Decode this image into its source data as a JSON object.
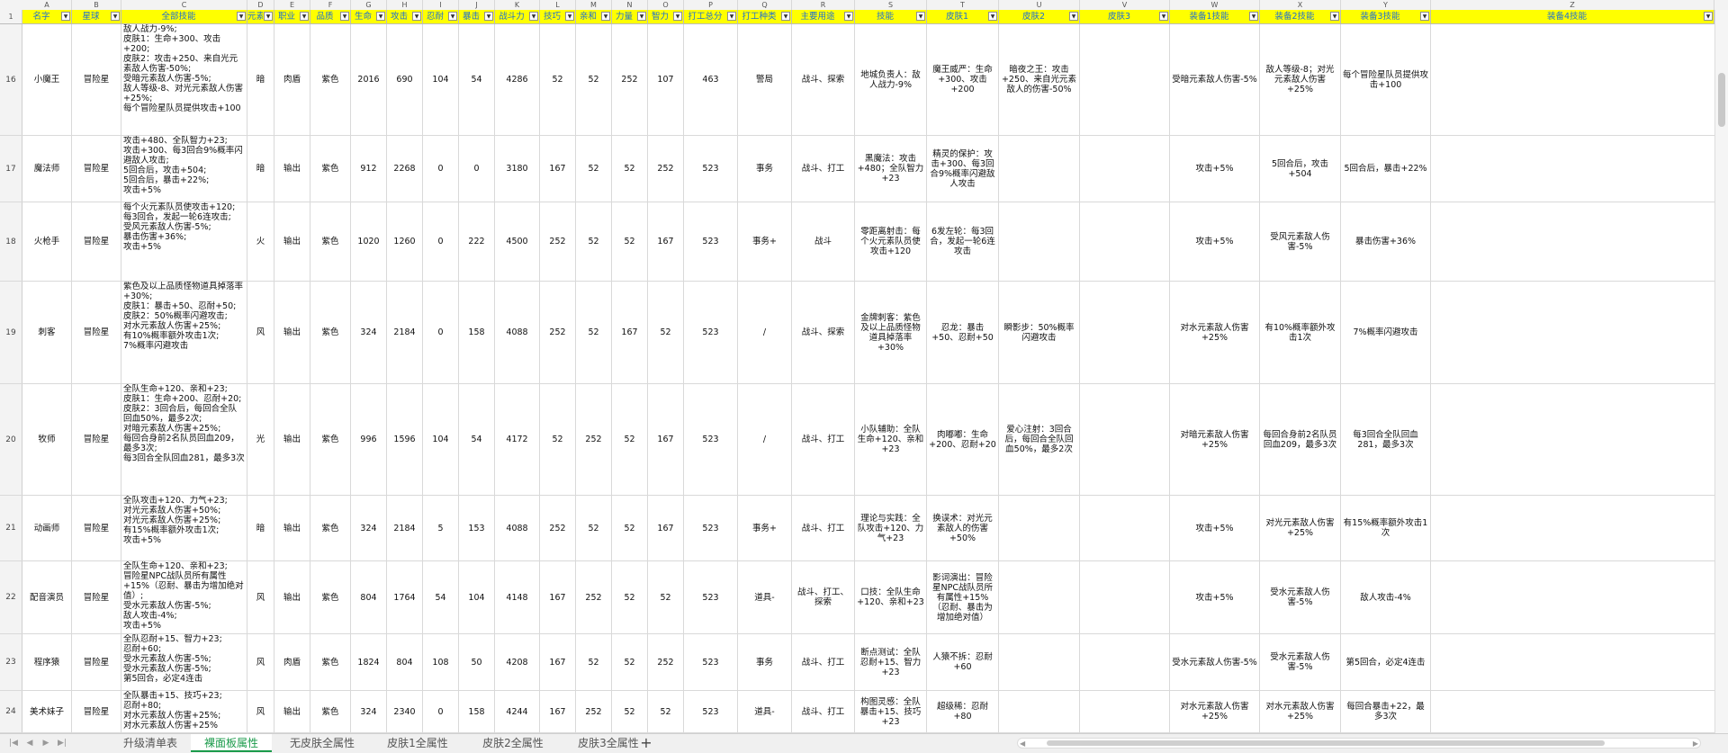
{
  "column_letters": [
    "A",
    "B",
    "C",
    "D",
    "E",
    "F",
    "G",
    "H",
    "I",
    "J",
    "K",
    "L",
    "M",
    "N",
    "O",
    "P",
    "Q",
    "R",
    "S",
    "T",
    "U",
    "V",
    "W",
    "X",
    "Y",
    "Z"
  ],
  "header_row_number": "1",
  "headers": [
    "名字",
    "星球",
    "全部技能",
    "元素",
    "职业",
    "品质",
    "生命",
    "攻击",
    "忍耐",
    "暴击",
    "战斗力",
    "技巧",
    "亲和",
    "力量",
    "智力",
    "打工总分",
    "打工种类",
    "主要用途",
    "技能",
    "皮肤1",
    "皮肤2",
    "皮肤3",
    "装备1技能",
    "装备2技能",
    "装备3技能",
    "装备4技能"
  ],
  "rows": [
    {
      "num": "16",
      "cells": [
        "小魔王",
        "冒险星",
        "敌人战力-9%;\n皮肤1：生命+300、攻击+200;\n皮肤2：攻击+250、来自光元素敌人伤害-50%;\n受暗元素敌人伤害-5%;\n敌人等级-8、对光元素敌人伤害+25%;\n每个冒险星队员提供攻击+100",
        "暗",
        "肉盾",
        "紫色",
        "2016",
        "690",
        "104",
        "54",
        "4286",
        "52",
        "52",
        "252",
        "107",
        "463",
        "警局",
        "战斗、探索",
        "地城负责人：敌人战力-9%",
        "魔王威严：生命+300、攻击+200",
        "暗夜之王：攻击+250、来自光元素敌人的伤害-50%",
        "",
        "受暗元素敌人伤害-5%",
        "敌人等级-8；对光元素敌人伤害+25%",
        "每个冒险星队员提供攻击+100"
      ]
    },
    {
      "num": "17",
      "cells": [
        "魔法师",
        "冒险星",
        "攻击+480、全队智力+23;\n攻击+300、每3回合9%概率闪避敌人攻击;\n5回合后，攻击+504;\n5回合后，暴击+22%;\n攻击+5%",
        "暗",
        "输出",
        "紫色",
        "912",
        "2268",
        "0",
        "0",
        "3180",
        "167",
        "52",
        "52",
        "252",
        "523",
        "事务",
        "战斗、打工",
        "黑魔法：攻击+480；全队智力+23",
        "精灵的保护：攻击+300、每3回合9%概率闪避敌人攻击",
        "",
        "",
        "攻击+5%",
        "5回合后，攻击+504",
        "5回合后，暴击+22%"
      ]
    },
    {
      "num": "18",
      "cells": [
        "火枪手",
        "冒险星",
        "每个火元素队员使攻击+120;\n每3回合，发起一轮6连攻击;\n受风元素敌人伤害-5%;\n暴击伤害+36%;\n攻击+5%",
        "火",
        "输出",
        "紫色",
        "1020",
        "1260",
        "0",
        "222",
        "4500",
        "252",
        "52",
        "52",
        "167",
        "523",
        "事务+",
        "战斗",
        "零距离射击：每个火元素队员使攻击+120",
        "6发左轮：每3回合，发起一轮6连攻击",
        "",
        "",
        "攻击+5%",
        "受风元素敌人伤害-5%",
        "暴击伤害+36%"
      ]
    },
    {
      "num": "19",
      "cells": [
        "刺客",
        "冒险星",
        "紫色及以上品质怪物道具掉落率+30%;\n皮肤1：暴击+50、忍耐+50;\n皮肤2：50%概率闪避攻击;\n对水元素敌人伤害+25%;\n有10%概率额外攻击1次;\n7%概率闪避攻击",
        "风",
        "输出",
        "紫色",
        "324",
        "2184",
        "0",
        "158",
        "4088",
        "252",
        "52",
        "167",
        "52",
        "523",
        "/",
        "战斗、探索",
        "金牌刺客：紫色及以上品质怪物道具掉落率+30%",
        "忍龙：暴击+50、忍耐+50",
        "瞬影步：50%概率闪避攻击",
        "",
        "对水元素敌人伤害+25%",
        "有10%概率额外攻击1次",
        "7%概率闪避攻击"
      ]
    },
    {
      "num": "20",
      "cells": [
        "牧师",
        "冒险星",
        "全队生命+120、亲和+23;\n皮肤1：生命+200、忍耐+20;\n皮肤2：3回合后，每回合全队回血50%，最多2次;\n对暗元素敌人伤害+25%;\n每回合身前2名队员回血209，最多3次;\n每3回合全队回血281，最多3次",
        "光",
        "输出",
        "紫色",
        "996",
        "1596",
        "104",
        "54",
        "4172",
        "52",
        "252",
        "52",
        "167",
        "523",
        "/",
        "战斗、打工",
        "小队辅助：全队生命+120、亲和+23",
        "肉嘟嘟：生命+200、忍耐+20",
        "爱心注射：3回合后，每回合全队回血50%，最多2次",
        "",
        "对暗元素敌人伤害+25%",
        "每回合身前2名队员回血209，最多3次",
        "每3回合全队回血281，最多3次"
      ]
    },
    {
      "num": "21",
      "cells": [
        "动画师",
        "冒险星",
        "全队攻击+120、力气+23;\n对光元素敌人伤害+50%;\n对光元素敌人伤害+25%;\n有15%概率额外攻击1次;\n攻击+5%",
        "暗",
        "输出",
        "紫色",
        "324",
        "2184",
        "5",
        "153",
        "4088",
        "252",
        "52",
        "52",
        "167",
        "523",
        "事务+",
        "战斗、打工",
        "理论与实践：全队攻击+120、力气+23",
        "换误术：对光元素敌人的伤害+50%",
        "",
        "",
        "攻击+5%",
        "对光元素敌人伤害+25%",
        "有15%概率额外攻击1次"
      ]
    },
    {
      "num": "22",
      "cells": [
        "配音演员",
        "冒险星",
        "全队生命+120、亲和+23;\n冒险星NPC战队员所有属性+15%（忍耐、暴击为增加绝对值）;\n受水元素敌人伤害-5%;\n敌人攻击-4%;\n攻击+5%",
        "风",
        "输出",
        "紫色",
        "804",
        "1764",
        "54",
        "104",
        "4148",
        "167",
        "252",
        "52",
        "52",
        "523",
        "道具-",
        "战斗、打工、探索",
        "口技：全队生命+120、亲和+23",
        "影词演出：冒险星NPC战队员所有属性+15%（忍耐、暴击为增加绝对值）",
        "",
        "",
        "攻击+5%",
        "受水元素敌人伤害-5%",
        "敌人攻击-4%"
      ]
    },
    {
      "num": "23",
      "cells": [
        "程序猿",
        "冒险星",
        "全队忍耐+15、智力+23;\n忍耐+60;\n受水元素敌人伤害-5%;\n受水元素敌人伤害-5%;\n第5回合，必定4连击",
        "风",
        "肉盾",
        "紫色",
        "1824",
        "804",
        "108",
        "50",
        "4208",
        "167",
        "52",
        "52",
        "252",
        "523",
        "事务",
        "战斗、打工",
        "断点测试：全队忍耐+15、智力+23",
        "人猿不拆：忍耐+60",
        "",
        "",
        "受水元素敌人伤害-5%",
        "受水元素敌人伤害-5%",
        "第5回合，必定4连击"
      ]
    },
    {
      "num": "24",
      "cells": [
        "美术妹子",
        "冒险星",
        "全队暴击+15、技巧+23;\n忍耐+80;\n对水元素敌人伤害+25%;\n对水元素敌人伤害+25%",
        "风",
        "输出",
        "紫色",
        "324",
        "2340",
        "0",
        "158",
        "4244",
        "167",
        "252",
        "52",
        "52",
        "523",
        "道具-",
        "战斗、打工",
        "构图灵感：全队暴击+15、技巧+23",
        "超级稀：忍耐+80",
        "",
        "",
        "对水元素敌人伤害+25%",
        "对水元素敌人伤害+25%",
        "每回合暴击+22，最多3次"
      ]
    }
  ],
  "sheet_tabs": [
    "升级清单表",
    "裸面板属性",
    "无皮肤全属性",
    "皮肤1全属性",
    "皮肤2全属性",
    "皮肤3全属性"
  ],
  "active_tab": "裸面板属性",
  "add_tab_symbol": "+",
  "colors": {
    "header_bg": "#ffff00",
    "header_text": "#1f6fd0",
    "active_tab": "#1a9a4a"
  }
}
